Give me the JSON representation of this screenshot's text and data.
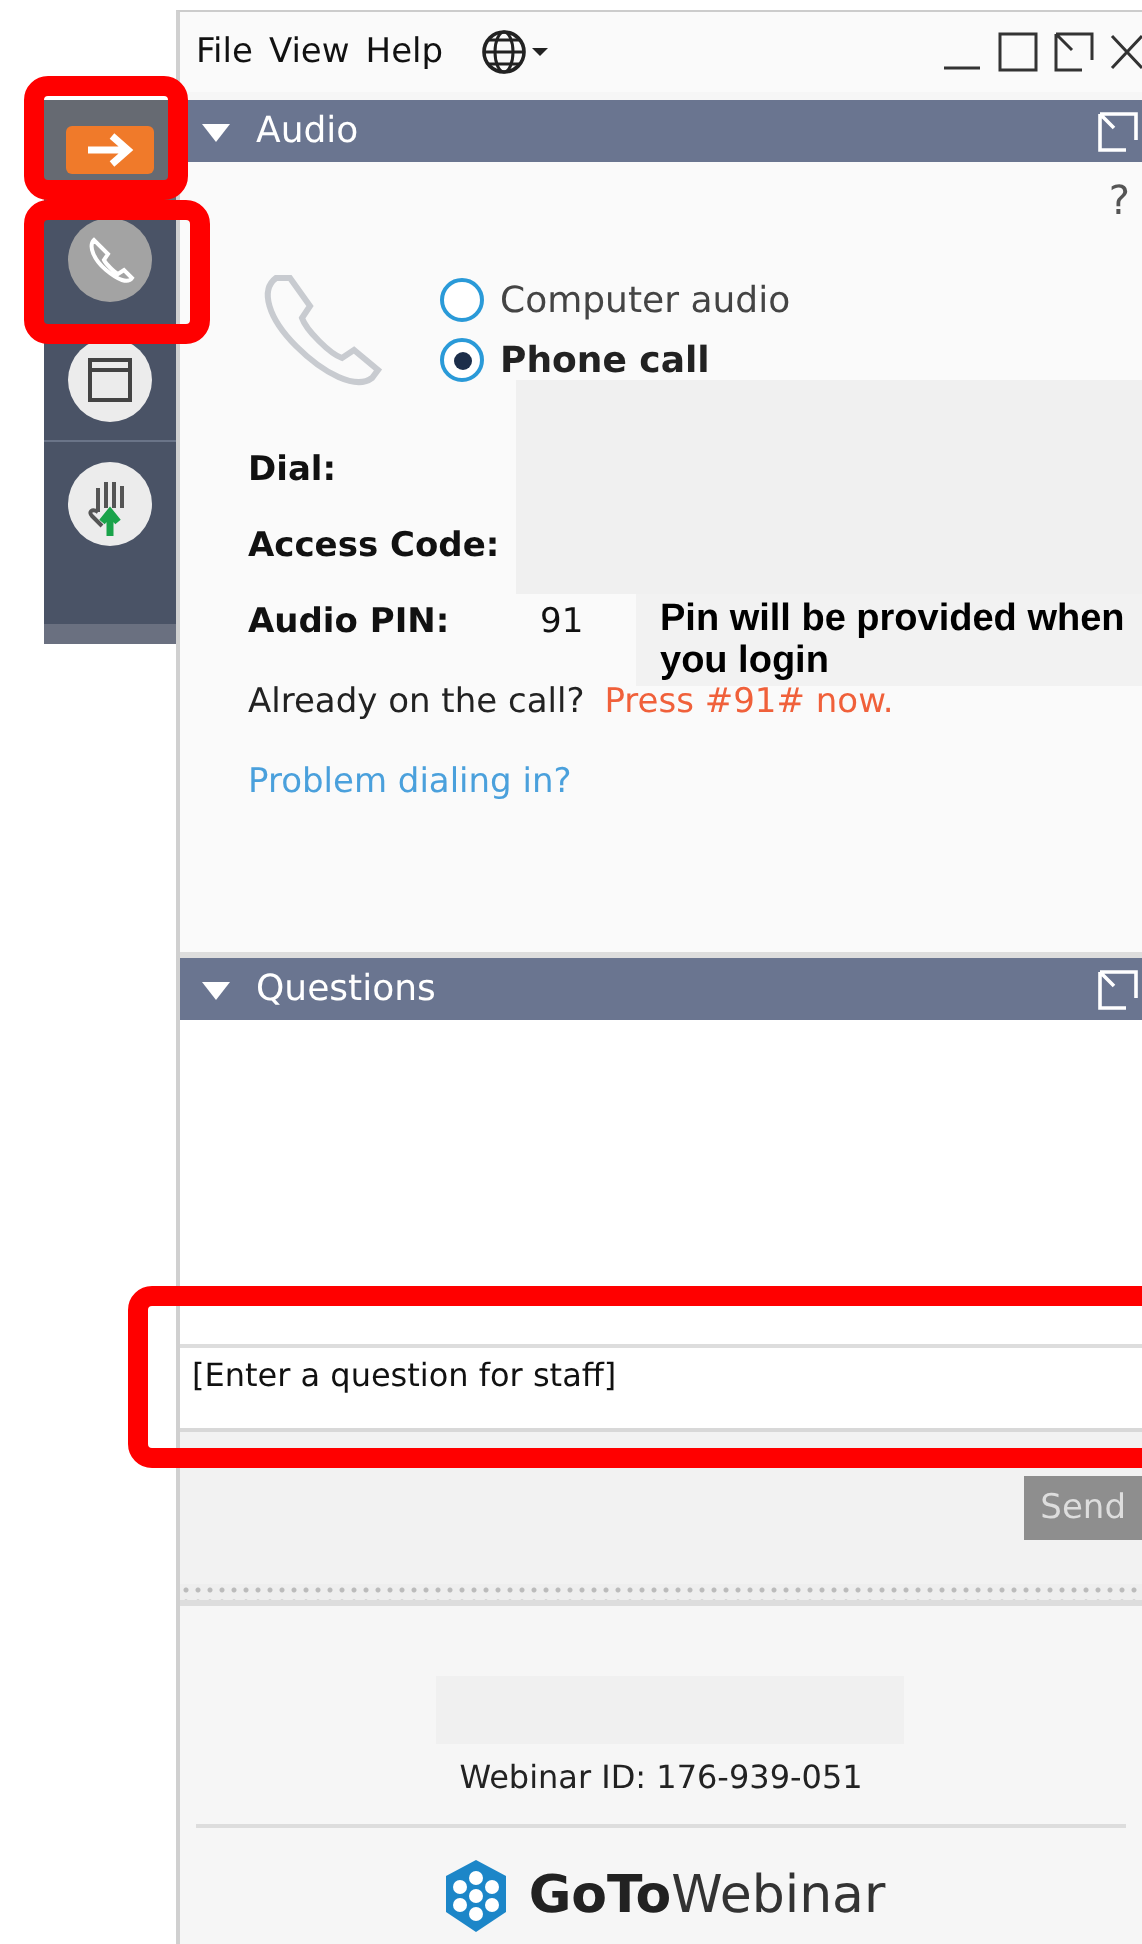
{
  "menu": [
    {
      "label": "File"
    },
    {
      "label": "View"
    },
    {
      "label": "Help"
    }
  ],
  "audio": {
    "title": "Audio",
    "help": "?",
    "options": [
      {
        "label": "Computer audio",
        "selected": false
      },
      {
        "label": "Phone call",
        "selected": true
      }
    ],
    "fields": [
      {
        "label": "Dial:"
      },
      {
        "label": "Access Code:"
      },
      {
        "label": "Audio PIN:",
        "value": "91"
      }
    ],
    "already": "Already on the call?",
    "press": "Press #91# now.",
    "problem_link": "Problem dialing in?"
  },
  "annotation": "Pin will be provided when you login",
  "questions": {
    "title": "Questions",
    "placeholder": "[Enter a question for staff]",
    "send": {
      "label": "Send",
      "disabled": true
    }
  },
  "footer": {
    "webinar_id": "Webinar ID: 176-939-051",
    "brand_bold": "GoTo",
    "brand_light": "Webinar"
  }
}
